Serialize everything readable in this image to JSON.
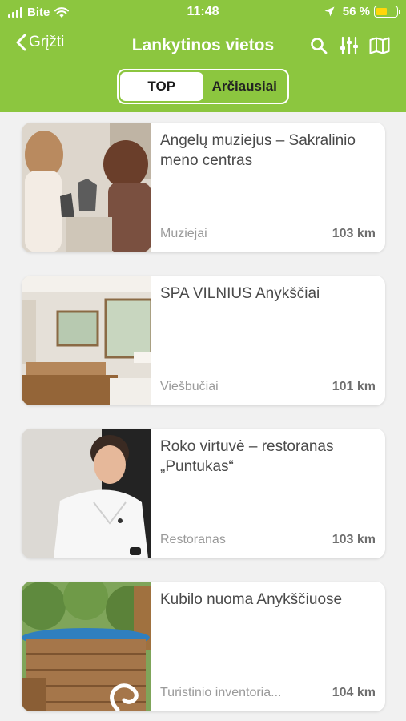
{
  "status_bar": {
    "carrier": "Bite",
    "time": "11:48",
    "battery_percent": "56 %",
    "battery_level": 0.56
  },
  "nav": {
    "back_label": "Grįžti",
    "title": "Lankytinos vietos"
  },
  "tabs": [
    {
      "label": "TOP",
      "active": true
    },
    {
      "label": "Arčiausiai",
      "active": false
    }
  ],
  "places": [
    {
      "title": "Angelų muziejus – Sakralinio meno centras",
      "category": "Muziejai",
      "distance": "103 km"
    },
    {
      "title": "SPA VILNIUS Anykščiai",
      "category": "Viešbučiai",
      "distance": "101 km"
    },
    {
      "title": "Roko virtuvė – restoranas „Puntukas“",
      "category": "Restoranas",
      "distance": "103 km"
    },
    {
      "title": "Kubilo nuoma Anykščiuose",
      "category": "Turistinio inventoria...",
      "distance": "104 km"
    }
  ],
  "colors": {
    "header_green": "#8cc63f",
    "battery_yellow": "#ffd60a"
  }
}
